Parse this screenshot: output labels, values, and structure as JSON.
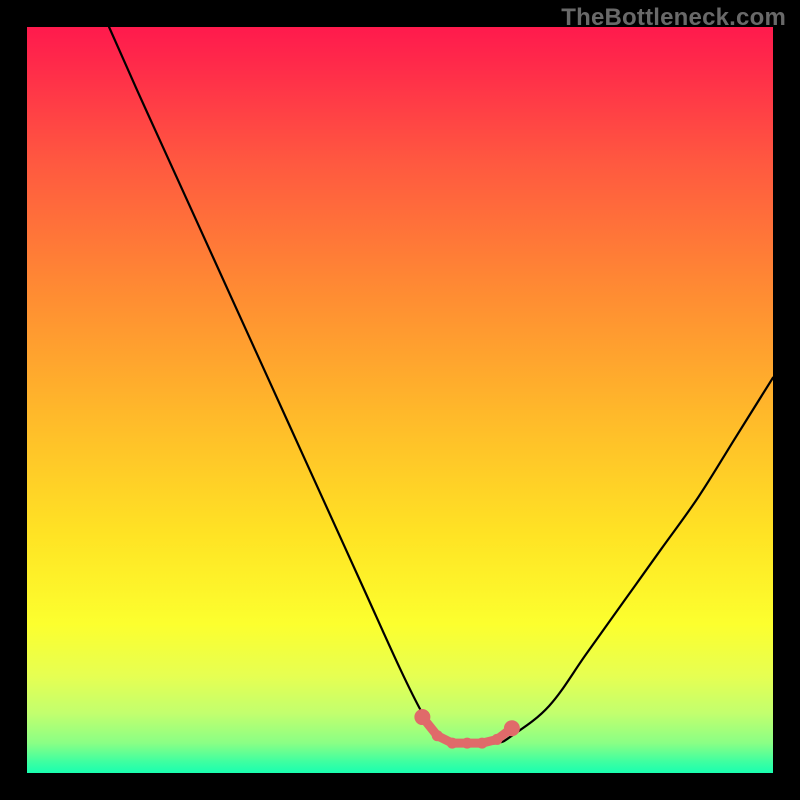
{
  "watermark": "TheBottleneck.com",
  "colors": {
    "gradient_stops": [
      {
        "offset": 0.0,
        "color": "#ff1a4d"
      },
      {
        "offset": 0.05,
        "color": "#ff2a4a"
      },
      {
        "offset": 0.18,
        "color": "#ff5840"
      },
      {
        "offset": 0.35,
        "color": "#ff8a33"
      },
      {
        "offset": 0.52,
        "color": "#ffb92a"
      },
      {
        "offset": 0.68,
        "color": "#ffe324"
      },
      {
        "offset": 0.8,
        "color": "#fcff2e"
      },
      {
        "offset": 0.87,
        "color": "#e6ff52"
      },
      {
        "offset": 0.92,
        "color": "#c2ff6e"
      },
      {
        "offset": 0.96,
        "color": "#8aff85"
      },
      {
        "offset": 0.985,
        "color": "#3effa1"
      },
      {
        "offset": 1.0,
        "color": "#19ffb0"
      }
    ],
    "curve": "#000000",
    "markers": "#e06a6a"
  },
  "chart_data": {
    "type": "line",
    "title": "",
    "xlabel": "",
    "ylabel": "",
    "xlim": [
      0,
      100
    ],
    "ylim": [
      0,
      100
    ],
    "series": [
      {
        "name": "bottleneck-curve",
        "x": [
          11,
          15,
          20,
          25,
          30,
          35,
          40,
          45,
          50,
          53,
          55,
          57,
          60,
          63,
          65,
          70,
          75,
          80,
          85,
          90,
          95,
          100
        ],
        "y": [
          100,
          91,
          80,
          69,
          58,
          47,
          36,
          25,
          14,
          8,
          5,
          4,
          4,
          4,
          5,
          9,
          16,
          23,
          30,
          37,
          45,
          53
        ]
      }
    ],
    "markers": {
      "name": "optimal-zone",
      "x": [
        53,
        55,
        57,
        59,
        61,
        63,
        65
      ],
      "y": [
        7.5,
        5.0,
        4.0,
        4.0,
        4.0,
        4.5,
        6.0
      ],
      "radius_first_last": 8,
      "radius_mid": 5.5
    }
  }
}
